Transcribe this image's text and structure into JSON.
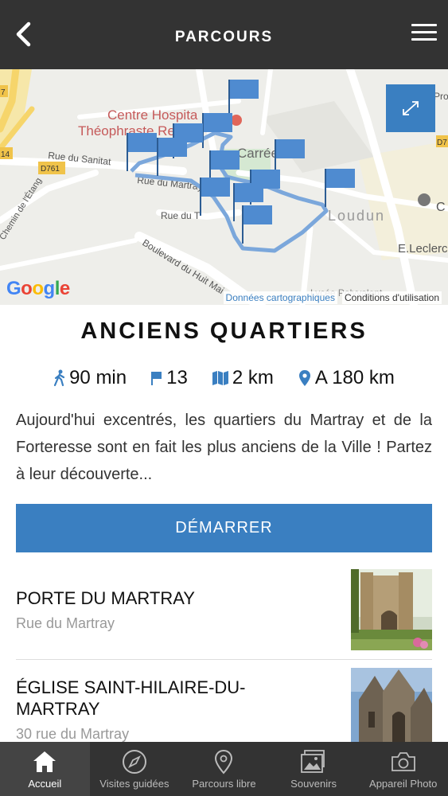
{
  "header": {
    "title": "PARCOURS",
    "back_icon": "chevron-left-icon",
    "menu_icon": "hamburger-menu-icon"
  },
  "map": {
    "labels": {
      "centre_hospitalier": "Centre Hospita",
      "theophraste": "Théophraste Re",
      "rue_sanitat": "Rue du Sanitat",
      "d761": "D761",
      "rue_martray": "Rue du Martray",
      "chemin_etang": "Chemin de l'Étang",
      "rue_du": "Rue du T",
      "boulevard": "Boulevard du Huit Mai",
      "carree": "Carrée",
      "loudun": "Loudun",
      "leclerc": "E.Leclerc",
      "lycee": "Lycée Polyvalent",
      "pro": "Pro",
      "route_14": "14",
      "route_7": "7",
      "d7": "D7",
      "c": "C"
    },
    "google_logo": [
      "G",
      "o",
      "o",
      "g",
      "l",
      "e"
    ],
    "data_link": "Données cartographiques",
    "terms_link": "Conditions d'utilisation",
    "expand_icon": "expand-icon",
    "accent": "#3a7fc1"
  },
  "route": {
    "title": "ANCIENS QUARTIERS",
    "duration": "90 min",
    "steps": "13",
    "distance": "2 km",
    "away": "A 180 km",
    "description": "Aujourd'hui excentrés, les quartiers du Martray et de la Forteresse sont en fait les plus anciens de la Ville ! Partez à leur découverte...",
    "start_label": "DÉMARRER"
  },
  "points": [
    {
      "name": "PORTE DU MARTRAY",
      "address": "Rue du Martray"
    },
    {
      "name": "ÉGLISE SAINT-HILAIRE-DU-MARTRAY",
      "address": "30 rue du Martray"
    }
  ],
  "tabs": [
    {
      "label": "Accueil",
      "icon": "home-icon"
    },
    {
      "label": "Visites guidées",
      "icon": "compass-icon"
    },
    {
      "label": "Parcours libre",
      "icon": "map-pin-icon"
    },
    {
      "label": "Souvenirs",
      "icon": "photos-icon"
    },
    {
      "label": "Appareil Photo",
      "icon": "camera-icon"
    }
  ]
}
